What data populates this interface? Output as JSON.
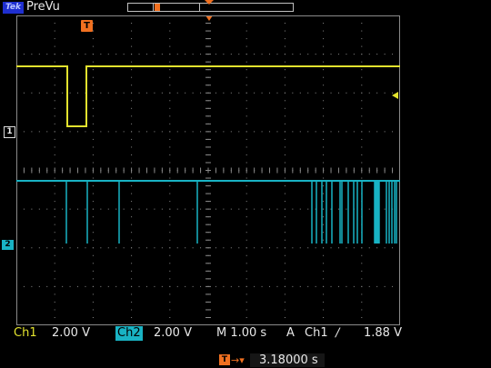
{
  "header": {
    "logo": "Tek",
    "status": "PreVu",
    "trigger_marker": "T"
  },
  "channels": {
    "ch1_marker": "1",
    "ch2_marker": "2"
  },
  "readout": {
    "ch1_label": "Ch1",
    "ch1_scale": "2.00 V",
    "ch2_label": "Ch2",
    "ch2_scale": "2.00 V",
    "time_scale": "M 1.00 s",
    "trigger_mode": "A",
    "trigger_source": "Ch1",
    "trigger_slope": "∕",
    "trigger_level": "1.88 V"
  },
  "position": {
    "icon": "T",
    "arrow": "→▾",
    "value": "3.18000 s"
  },
  "colors": {
    "ch1": "#e2e22e",
    "ch2": "#19b3c4",
    "trigger": "#f07020",
    "grid": "#8a8a8a"
  },
  "icons": {
    "trigger_position": "trigger-position-icon",
    "trigger_level": "trigger-level-arrow-icon"
  }
}
